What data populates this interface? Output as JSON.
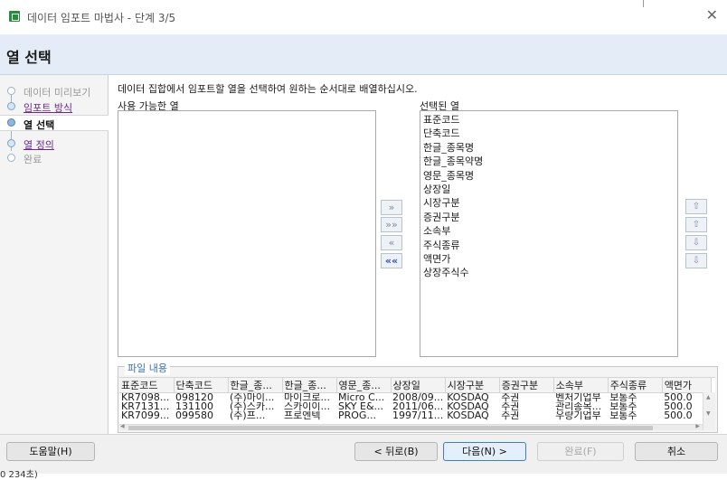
{
  "window": {
    "title": "데이터 임포트 마법사 - 단계 3/5",
    "close_glyph": "✕"
  },
  "header": {
    "title": "열 선택"
  },
  "sidebar": {
    "steps": [
      {
        "label": "데이터 미리보기",
        "state": "disabled"
      },
      {
        "label": "임포트 방식",
        "state": "link"
      },
      {
        "label": "열 선택",
        "state": "current"
      },
      {
        "label": "열 정의",
        "state": "link"
      },
      {
        "label": "완료",
        "state": "disabled"
      }
    ]
  },
  "main": {
    "instruction": "데이터 집합에서 임포트할 열을 선택하여 원하는 순서대로 배열하십시오.",
    "available_label": "사용 가능한 열",
    "selected_label": "선택된 열",
    "selected_columns": [
      "표준코드",
      "단축코드",
      "한글_종목명",
      "한글_종목약명",
      "영문_종목명",
      "상장일",
      "시장구분",
      "증권구분",
      "소속부",
      "주식종류",
      "액면가",
      "상장주식수"
    ],
    "transfer_buttons": [
      "»",
      "»»",
      "«",
      "««"
    ],
    "order_buttons": [
      "⇧",
      "⇧",
      "⇩",
      "⇩"
    ]
  },
  "preview": {
    "legend": "파일 내용",
    "headers": [
      "표준코드",
      "단축코드",
      "한글_종...",
      "한글_종...",
      "영문_종...",
      "상장일",
      "시장구분",
      "증권구분",
      "소속부",
      "주식종류",
      "액면가"
    ],
    "rows": [
      [
        "KR7098...",
        "098120",
        "(주)마이...",
        "마이크로...",
        "Micro C...",
        "2008/09...",
        "KOSDAQ",
        "주권",
        "벤처기업부",
        "보통주",
        "500.0"
      ],
      [
        "KR7131...",
        "131100",
        "(주)스카...",
        "스카이이...",
        "SKY E&...",
        "2011/06...",
        "KOSDAQ",
        "주권",
        "관리종목...",
        "보통주",
        "500.0"
      ],
      [
        "KR7099...",
        "099580",
        "(주)프...",
        "프로엔텍",
        "PROG...",
        "1997/11...",
        "KOSDAQ",
        "주권",
        "우량기업부",
        "보통주",
        "500.0"
      ]
    ]
  },
  "footer": {
    "help": "도움말(H)",
    "back": "< 뒤로(B)",
    "next": "다음(N) >",
    "finish": "완료(F)",
    "cancel": "취소",
    "status": "0 234초)"
  }
}
